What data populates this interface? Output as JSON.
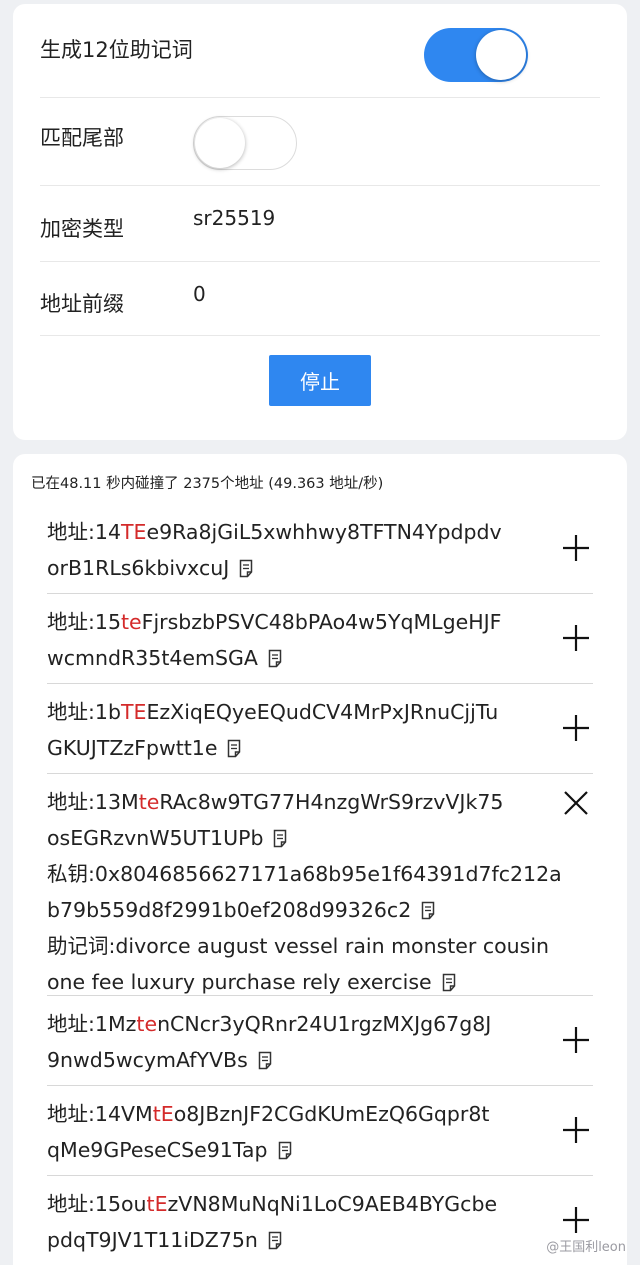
{
  "settings": {
    "mnemonic12": {
      "label": "生成12位助记词",
      "enabled": true
    },
    "match_suffix": {
      "label": "匹配尾部",
      "enabled": false
    },
    "encryption": {
      "label": "加密类型",
      "value": "sr25519"
    },
    "prefix": {
      "label": "地址前缀",
      "value": "0"
    },
    "stop_label": "停止"
  },
  "results": {
    "summary": "已在48.11 秒内碰撞了 2375个地址 (49.363 地址/秒)",
    "highlight_color": "#d42a2a",
    "entries": [
      {
        "address": {
          "prefix": "地址:14",
          "match": "TE",
          "rest1": "e9Ra8jGiL5xwhhwy8TFTN4Ypdpdv",
          "line2": "orB1RLs6kbivxcuJ"
        },
        "expanded": false
      },
      {
        "address": {
          "prefix": "地址:15",
          "match": "te",
          "rest1": "FjrsbzbPSVC48bPAo4w5YqMLgeHJF",
          "line2": "wcmndR35t4emSGA"
        },
        "expanded": false
      },
      {
        "address": {
          "prefix": "地址:1b",
          "match": "TE",
          "rest1": "EzXiqEQyeEQudCV4MrPxJRnuCjjTu",
          "line2": "GKUJTZzFpwtt1e"
        },
        "expanded": false
      },
      {
        "address": {
          "prefix": "地址:13M",
          "match": "te",
          "rest1": "RAc8w9TG77H4nzgWrS9rzvVJk75",
          "line2": "osEGRzvnW5UT1UPb"
        },
        "private_key": {
          "line1": "私钥:0x8046856627171a68b95e1f64391d7fc212a",
          "line2": "b79b559d8f2991b0ef208d99326c2"
        },
        "mnemonic": {
          "line1": "助记词:divorce august vessel rain monster cousin",
          "line2": "one fee luxury purchase rely exercise"
        },
        "expanded": true
      },
      {
        "address": {
          "prefix": "地址:1Mz",
          "match": "te",
          "rest1": "nCNcr3yQRnr24U1rgzMXJg67g8J",
          "line2": "9nwd5wcymAfYVBs"
        },
        "expanded": false
      },
      {
        "address": {
          "prefix": "地址:14VM",
          "match": "tE",
          "rest1": "o8JBznJF2CGdKUmEzQ6Gqpr8t",
          "line2": "qMe9GPeseCSe91Tap"
        },
        "expanded": false
      },
      {
        "address": {
          "prefix": "地址:15ou",
          "match": "tE",
          "rest1": "zVN8MuNqNi1LoC9AEB4BYGcbe",
          "line2": "pdqT9JV1T11iDZ75n"
        },
        "expanded": false
      }
    ]
  },
  "watermark": "@王国利leon",
  "icons": {
    "copy": "copy-icon",
    "expand": "plus-icon",
    "collapse": "close-icon"
  },
  "colors": {
    "accent": "#2f87f0",
    "background": "#eef0f3",
    "card": "#ffffff"
  }
}
